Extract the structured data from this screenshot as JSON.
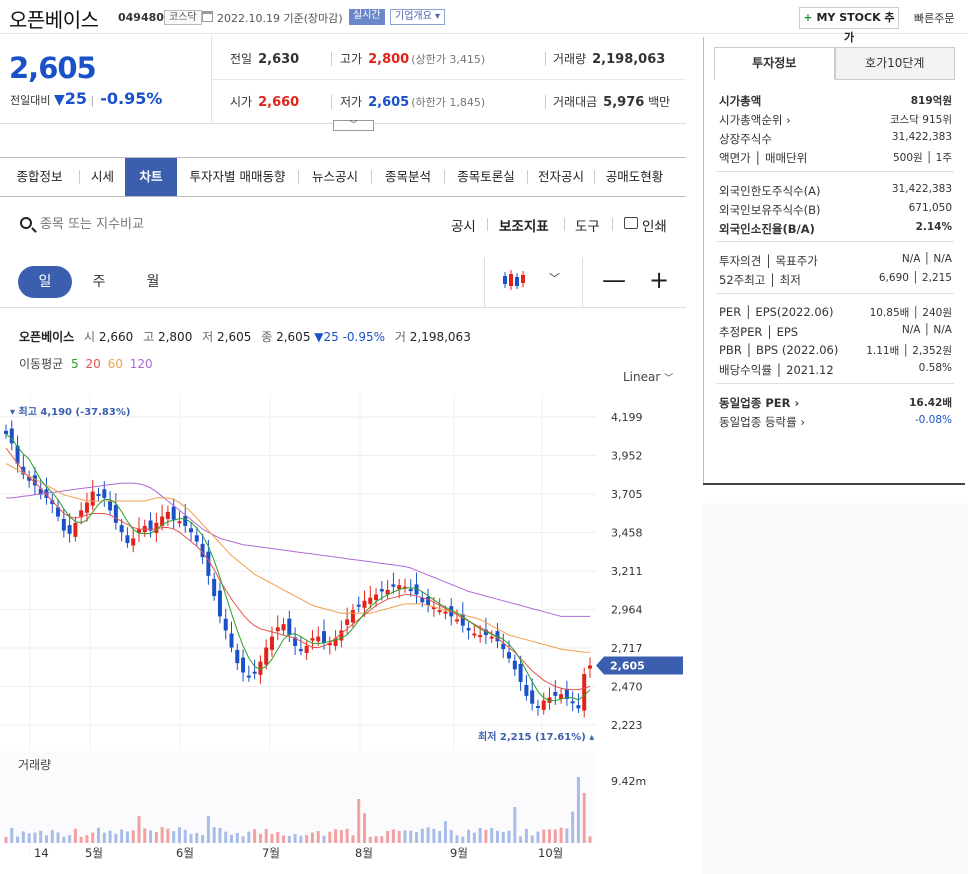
{
  "header": {
    "stock_name": "오픈베이스",
    "stock_code": "049480",
    "market": "코스닥",
    "date_text": "2022.10.19 기준(장마감)",
    "live_label": "실시간",
    "corp_overview": "기업개요 ▾",
    "mystock_label": "MY STOCK 추가",
    "quick_order": "빠른주문"
  },
  "price": {
    "current": "2,605",
    "change_label": "전일대비",
    "change_arrow": "▼",
    "change_value": "25",
    "change_pct": "-0.95%",
    "prev_close_label": "전일",
    "prev_close": "2,630",
    "open_label": "시가",
    "open": "2,660",
    "high_label": "고가",
    "high": "2,800",
    "upper_limit": "(상한가 3,415)",
    "low_label": "저가",
    "low": "2,605",
    "lower_limit": "(하한가 1,845)",
    "volume_label": "거래량",
    "volume": "2,198,063",
    "amount_label": "거래대금",
    "amount": "5,976",
    "amount_unit": "백만"
  },
  "tabs": [
    "종합정보",
    "시세",
    "차트",
    "투자자별 매매동향",
    "뉴스공시",
    "종목분석",
    "종목토론실",
    "전자공시",
    "공매도현황"
  ],
  "active_tab": "차트",
  "toolbar": {
    "search_placeholder": "종목 또는 지수비교",
    "disclosure": "공시",
    "indicator": "보조지표",
    "tool": "도구",
    "print": "인쇄"
  },
  "periods": [
    "일",
    "주",
    "월"
  ],
  "chart_header": {
    "name": "오픈베이스",
    "open_lbl": "시",
    "open": "2,660",
    "high_lbl": "고",
    "high": "2,800",
    "low_lbl": "저",
    "low": "2,605",
    "close_lbl": "종",
    "close": "2,605",
    "change": "▼25 -0.95%",
    "vol_lbl": "거",
    "vol": "2,198,063",
    "ma_label": "이동평균",
    "ma": [
      "5",
      "20",
      "60",
      "120"
    ],
    "scale": "Linear"
  },
  "colors": {
    "up": "#e2231a",
    "down": "#1a51c9",
    "ma5": "#2ca02c",
    "ma20": "#e8534f",
    "ma60": "#f0a04b",
    "ma120": "#b06ad8",
    "accent": "#3b5fae"
  },
  "chart_data": {
    "type": "candlestick",
    "y_ticks": [
      "4,199",
      "3,952",
      "3,705",
      "3,458",
      "3,211",
      "2,964",
      "2,717",
      "2,470",
      "2,223"
    ],
    "ylim": [
      2223,
      4199
    ],
    "x_ticks": [
      "14",
      "5월",
      "6월",
      "7월",
      "8월",
      "9월",
      "10월"
    ],
    "current_price_label": "2,605",
    "max_label": "최고 4,190 (-37.83%)",
    "min_label": "최저 2,215 (17.61%)",
    "volume_label": "거래량",
    "volume_max_label": "9.42m",
    "close": [
      4090,
      4030,
      3900,
      3830,
      3790,
      3760,
      3700,
      3680,
      3640,
      3560,
      3470,
      3450,
      3520,
      3600,
      3650,
      3720,
      3700,
      3680,
      3600,
      3520,
      3460,
      3390,
      3420,
      3480,
      3500,
      3470,
      3520,
      3560,
      3590,
      3540,
      3530,
      3500,
      3460,
      3400,
      3300,
      3180,
      3050,
      2920,
      2830,
      2720,
      2620,
      2560,
      2530,
      2560,
      2630,
      2720,
      2790,
      2850,
      2870,
      2800,
      2730,
      2700,
      2730,
      2780,
      2790,
      2750,
      2750,
      2780,
      2830,
      2900,
      2960,
      2990,
      3020,
      3040,
      3060,
      3080,
      3090,
      3110,
      3120,
      3110,
      3090,
      3060,
      3010,
      2990,
      2980,
      2960,
      2950,
      2920,
      2900,
      2860,
      2830,
      2810,
      2800,
      2800,
      2790,
      2760,
      2710,
      2650,
      2580,
      2500,
      2410,
      2360,
      2340,
      2380,
      2400,
      2410,
      2420,
      2390,
      2370,
      2330,
      2550,
      2605
    ],
    "ma20": [
      4000,
      3950,
      3900,
      3850,
      3810,
      3780,
      3740,
      3700,
      3660,
      3620,
      3580,
      3560,
      3550,
      3560,
      3570,
      3580,
      3580,
      3580,
      3570,
      3550,
      3530,
      3510,
      3490,
      3480,
      3480,
      3480,
      3480,
      3490,
      3490,
      3480,
      3460,
      3430,
      3400,
      3370,
      3330,
      3280,
      3220,
      3150,
      3090,
      3030,
      2980,
      2930,
      2890,
      2860,
      2840,
      2830,
      2820,
      2810,
      2800,
      2790,
      2780,
      2760,
      2740,
      2720,
      2720,
      2730,
      2750,
      2780,
      2810,
      2840,
      2870,
      2900,
      2930,
      2960,
      2990,
      3010,
      3030,
      3040,
      3050,
      3060,
      3060,
      3050,
      3040,
      3030,
      3010,
      2990,
      2970,
      2950,
      2930,
      2910,
      2890,
      2870,
      2850,
      2830,
      2810,
      2780,
      2750,
      2720,
      2690,
      2650,
      2610,
      2570,
      2540,
      2510,
      2490,
      2470,
      2460,
      2450,
      2450,
      2450,
      2460,
      2470
    ],
    "ma60": [
      3900,
      3880,
      3860,
      3840,
      3820,
      3800,
      3780,
      3760,
      3740,
      3720,
      3700,
      3690,
      3680,
      3670,
      3660,
      3660,
      3660,
      3660,
      3660,
      3660,
      3660,
      3660,
      3660,
      3660,
      3660,
      3670,
      3680,
      3680,
      3680,
      3670,
      3650,
      3620,
      3590,
      3550,
      3510,
      3470,
      3430,
      3390,
      3350,
      3310,
      3280,
      3250,
      3220,
      3190,
      3170,
      3150,
      3130,
      3110,
      3090,
      3070,
      3050,
      3030,
      3010,
      2990,
      2980,
      2970,
      2960,
      2950,
      2940,
      2940,
      2940,
      2940,
      2940,
      2940,
      2950,
      2960,
      2970,
      2980,
      2990,
      3000,
      3000,
      3000,
      3000,
      2990,
      2980,
      2970,
      2960,
      2950,
      2940,
      2930,
      2920,
      2910,
      2900,
      2880,
      2860,
      2840,
      2820,
      2800,
      2790,
      2780,
      2770,
      2760,
      2750,
      2740,
      2730,
      2720,
      2710,
      2705,
      2700,
      2695,
      2690,
      2690
    ],
    "ma120": [
      3680,
      3680,
      3685,
      3690,
      3695,
      3700,
      3705,
      3710,
      3715,
      3720,
      3725,
      3730,
      3735,
      3740,
      3745,
      3750,
      3755,
      3760,
      3765,
      3770,
      3775,
      3775,
      3775,
      3770,
      3760,
      3745,
      3720,
      3690,
      3660,
      3630,
      3600,
      3570,
      3540,
      3510,
      3480,
      3460,
      3440,
      3420,
      3410,
      3400,
      3390,
      3380,
      3375,
      3370,
      3365,
      3360,
      3355,
      3350,
      3345,
      3340,
      3335,
      3330,
      3325,
      3320,
      3315,
      3310,
      3305,
      3300,
      3295,
      3290,
      3285,
      3280,
      3275,
      3270,
      3265,
      3260,
      3255,
      3250,
      3245,
      3240,
      3230,
      3215,
      3200,
      3185,
      3170,
      3155,
      3140,
      3125,
      3110,
      3095,
      3080,
      3070,
      3060,
      3050,
      3040,
      3030,
      3020,
      3010,
      3000,
      2990,
      2980,
      2970,
      2960,
      2950,
      2940,
      2930,
      2920,
      2920,
      2920,
      2920,
      2920,
      2920
    ]
  },
  "right_panel": {
    "tabs": [
      "투자정보",
      "호가10단계"
    ],
    "rows": [
      {
        "label": "시가총액",
        "value": "819억원",
        "bold": true
      },
      {
        "label": "시가총액순위 ›",
        "value": "코스닥 915위"
      },
      {
        "label": "상장주식수",
        "value": "31,422,383"
      },
      {
        "label": "액면가 │ 매매단위",
        "value": "500원 │ 1주"
      },
      {
        "label": "외국인한도주식수(A)",
        "value": "31,422,383"
      },
      {
        "label": "외국인보유주식수(B)",
        "value": "671,050"
      },
      {
        "label": "외국인소진율(B/A)",
        "value": "2.14%",
        "bold": true
      },
      {
        "label": "투자의견 │ 목표주가",
        "value": "N/A │ N/A"
      },
      {
        "label": "52주최고 │ 최저",
        "value": "6,690 │ 2,215"
      },
      {
        "label": "PER │ EPS(2022.06)",
        "value": "10.85배 │ 240원"
      },
      {
        "label": "추정PER │ EPS",
        "value": "N/A │ N/A"
      },
      {
        "label": "PBR │ BPS (2022.06)",
        "value": "1.11배 │ 2,352원"
      },
      {
        "label": "배당수익률 │ 2021.12",
        "value": "0.58%"
      },
      {
        "label": "동일업종 PER ›",
        "value": "16.42배",
        "bold": true
      },
      {
        "label": "동일업종 등락률 ›",
        "value": "-0.08%",
        "blue": true
      }
    ]
  }
}
